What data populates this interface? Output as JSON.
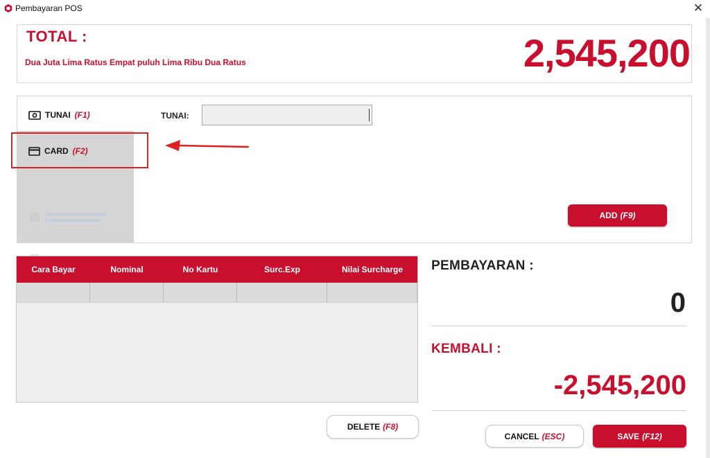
{
  "window": {
    "title": "Pembayaran POS",
    "close_glyph": "✕",
    "app_icon": "hexagon-logo-icon",
    "accent_color": "#c8102e"
  },
  "total": {
    "label": "TOTAL :",
    "words": "Dua Juta Lima Ratus Empat puluh Lima Ribu Dua Ratus",
    "amount": "2,545,200"
  },
  "methods": [
    {
      "label": "TUNAI",
      "fkey": "(F1)",
      "icon": "cash-icon"
    },
    {
      "label": "CARD",
      "fkey": "(F2)",
      "icon": "credit-card-icon"
    }
  ],
  "tunai_field": {
    "label": "TUNAI:",
    "value": ""
  },
  "add_button": {
    "label": "ADD",
    "fkey": "(F9)"
  },
  "table": {
    "columns": [
      "Cara Bayar",
      "Nominal",
      "No Kartu",
      "Surc.Exp",
      "Nilai Surcharge"
    ],
    "rows": []
  },
  "delete_button": {
    "label": "DELETE",
    "fkey": "(F8)"
  },
  "summary": {
    "pembayaran_label": "PEMBAYARAN :",
    "pembayaran_value": "0",
    "kembali_label": "KEMBALI :",
    "kembali_value": "-2,545,200"
  },
  "cancel_button": {
    "label": "CANCEL",
    "fkey": "(ESC)"
  },
  "save_button": {
    "label": "SAVE",
    "fkey": "(F12)"
  }
}
